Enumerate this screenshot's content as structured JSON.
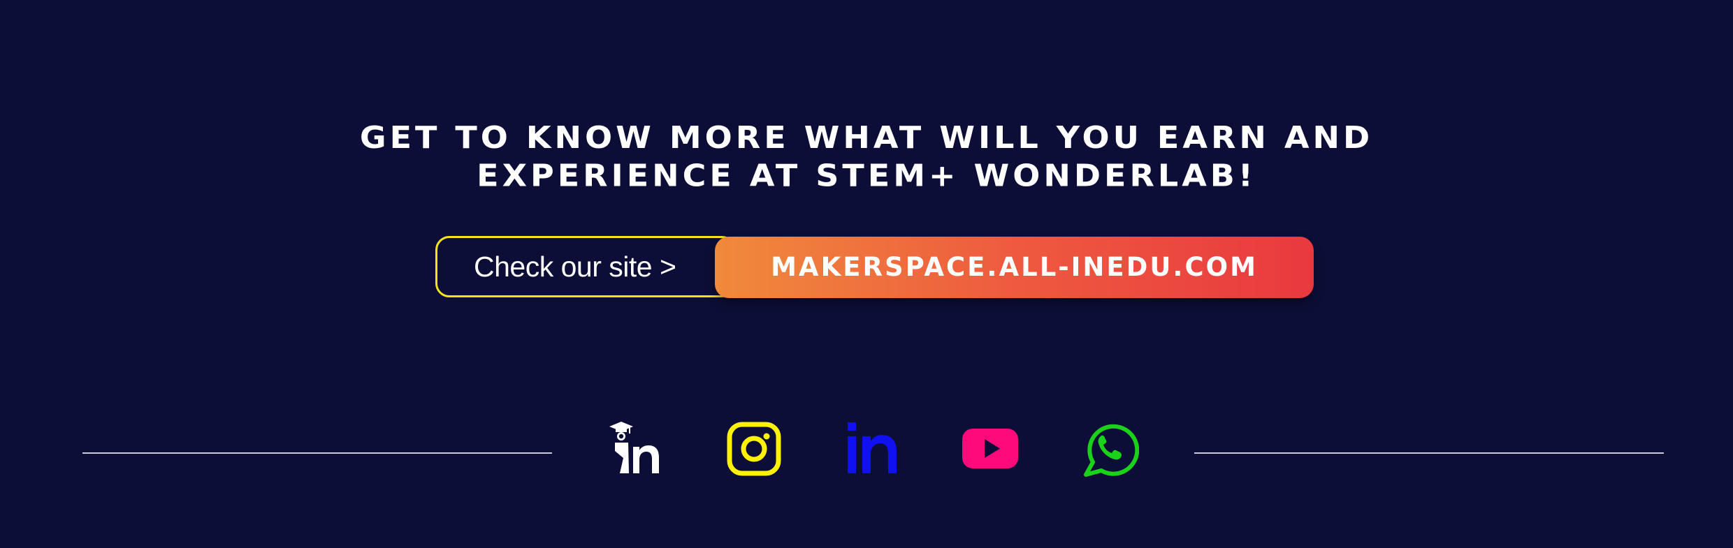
{
  "headline": {
    "line1": "GET TO KNOW MORE WHAT WILL YOU EARN AND",
    "line2": "EXPERIENCE AT STEM+ WONDERLAB!"
  },
  "cta": {
    "label": "Check our site >",
    "url_text": "MAKERSPACE.ALL-INEDU.COM",
    "colors": {
      "outline": "#f2e321",
      "gradient_start": "#f08a3c",
      "gradient_end": "#e9393f"
    }
  },
  "social": {
    "icons": [
      {
        "name": "all-inedu-logo-icon",
        "color": "#ffffff"
      },
      {
        "name": "instagram-icon",
        "color": "#fff200"
      },
      {
        "name": "linkedin-icon",
        "color": "#1010f0"
      },
      {
        "name": "youtube-icon",
        "color": "#ff0a7a"
      },
      {
        "name": "whatsapp-icon",
        "color": "#19d219"
      }
    ]
  },
  "colors": {
    "background": "#0c0e37",
    "text": "#ffffff",
    "divider": "#c9cbe0"
  }
}
